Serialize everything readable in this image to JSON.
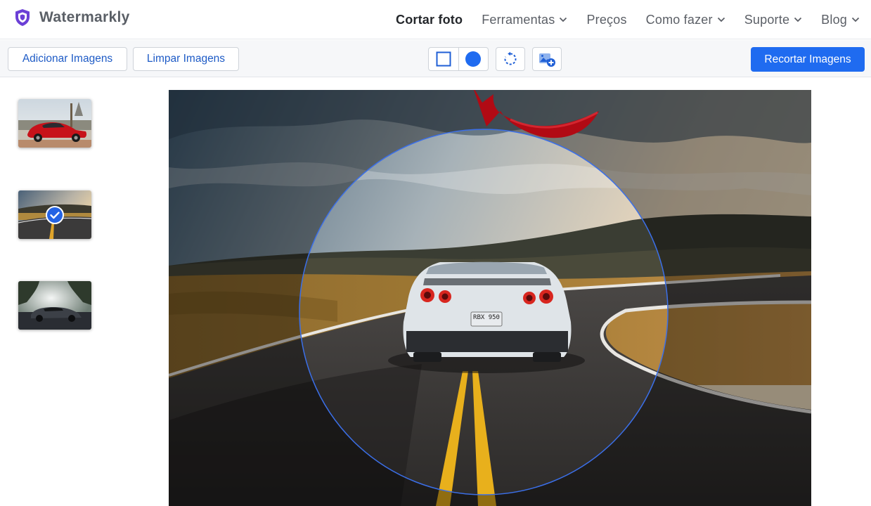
{
  "brand": {
    "name": "Watermarkly",
    "logo_icon": "shield-logo-icon",
    "logo_color": "#6b3fd6"
  },
  "nav": {
    "items": [
      {
        "label": "Cortar foto",
        "active": true,
        "dropdown": false
      },
      {
        "label": "Ferramentas",
        "active": false,
        "dropdown": true
      },
      {
        "label": "Preços",
        "active": false,
        "dropdown": false
      },
      {
        "label": "Como fazer",
        "active": false,
        "dropdown": true
      },
      {
        "label": "Suporte",
        "active": false,
        "dropdown": true
      },
      {
        "label": "Blog",
        "active": false,
        "dropdown": true
      }
    ]
  },
  "toolbar": {
    "add_images": "Adicionar Imagens",
    "clear_images": "Limpar Imagens",
    "shapes": [
      {
        "name": "rectangle",
        "icon": "square-outline-icon",
        "selected": false
      },
      {
        "name": "circle",
        "icon": "circle-filled-icon",
        "selected": true
      }
    ],
    "rotate_icon": "rotate-icon",
    "add_image_icon": "image-add-icon",
    "crop_button": "Recortar Imagens",
    "accent_color": "#1f6bf0"
  },
  "thumbnails": [
    {
      "subject": "red sports car",
      "selected": false
    },
    {
      "subject": "road at sunset",
      "selected": true
    },
    {
      "subject": "dark car under trees",
      "selected": false
    }
  ],
  "editor": {
    "crop_shape": "circle",
    "annotation": "red-arrow-pointing-to-circle-tool",
    "plate_text": "RBX 950"
  }
}
